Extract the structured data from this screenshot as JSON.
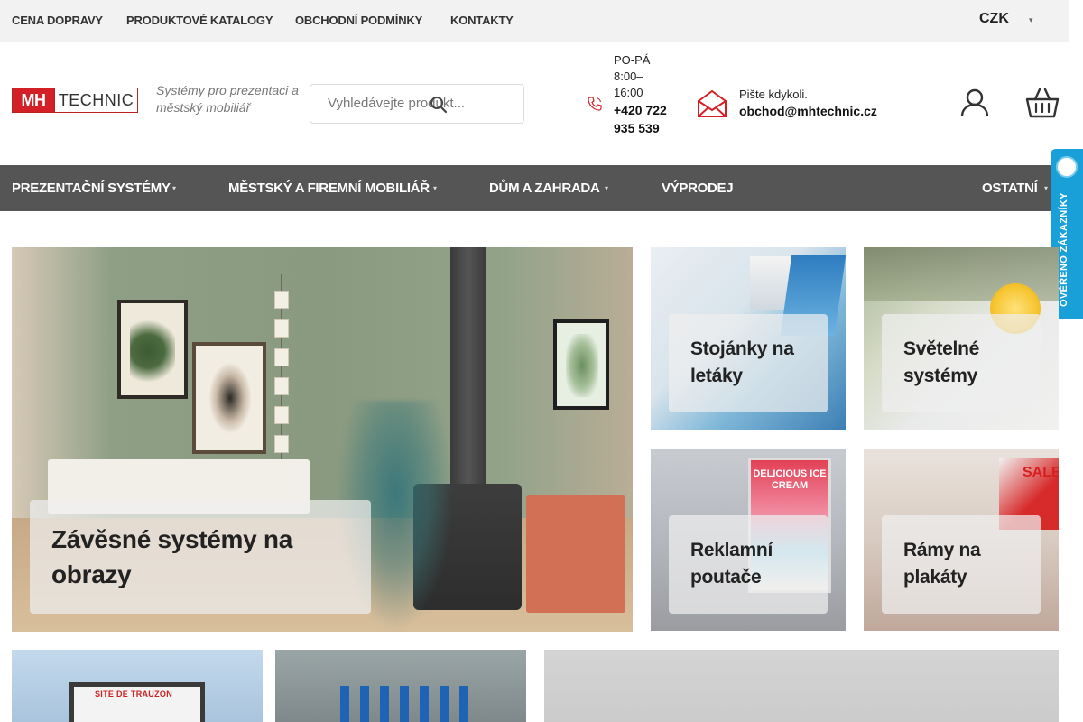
{
  "topbar": {
    "links": [
      "CENA DOPRAVY",
      "PRODUKTOVÉ KATALOGY",
      "OBCHODNÍ PODMÍNKY",
      "KONTAKTY"
    ],
    "currency": "CZK",
    "currency_caret": "▾"
  },
  "header": {
    "logo_mh": "MH",
    "logo_technic": "TECHNIC",
    "tagline": "Systémy pro prezentaci a městský mobiliář",
    "search_placeholder": "Vyhledávejte produkt...",
    "hours": "PO-PÁ 8:00–16:00",
    "phone": "+420 722 935 539",
    "mail_label": "Pište kdykoli.",
    "mail_address": "obchod@mhtechnic.cz"
  },
  "nav": {
    "items": [
      "PREZENTAČNÍ SYSTÉMY",
      "MĚSTSKÝ A FIREMNÍ MOBILIÁŘ",
      "DŮM A ZAHRADA",
      "VÝPRODEJ",
      "OSTATNÍ"
    ],
    "caret": "▾"
  },
  "badge": {
    "text": "OVĚŘENO ZÁKAZNÍKY"
  },
  "tiles": {
    "main": "Závěsné systémy na obrazy",
    "stojanky": "Stojánky na letáky",
    "svetelne": "Světelné systémy",
    "poutace": "Reklamní poutače",
    "ramy": "Rámy na plakáty"
  },
  "tile_images": {
    "poutace_board": "DELICIOUS ICE CREAM",
    "ramy_poster": "SALE",
    "b1_sign": "SITE DE TRAUZON"
  },
  "colors": {
    "nav_bg": "#555555",
    "topbar_bg": "#f2f2f2",
    "logo_red": "#d32027",
    "badge_blue": "#1aa0d8"
  }
}
